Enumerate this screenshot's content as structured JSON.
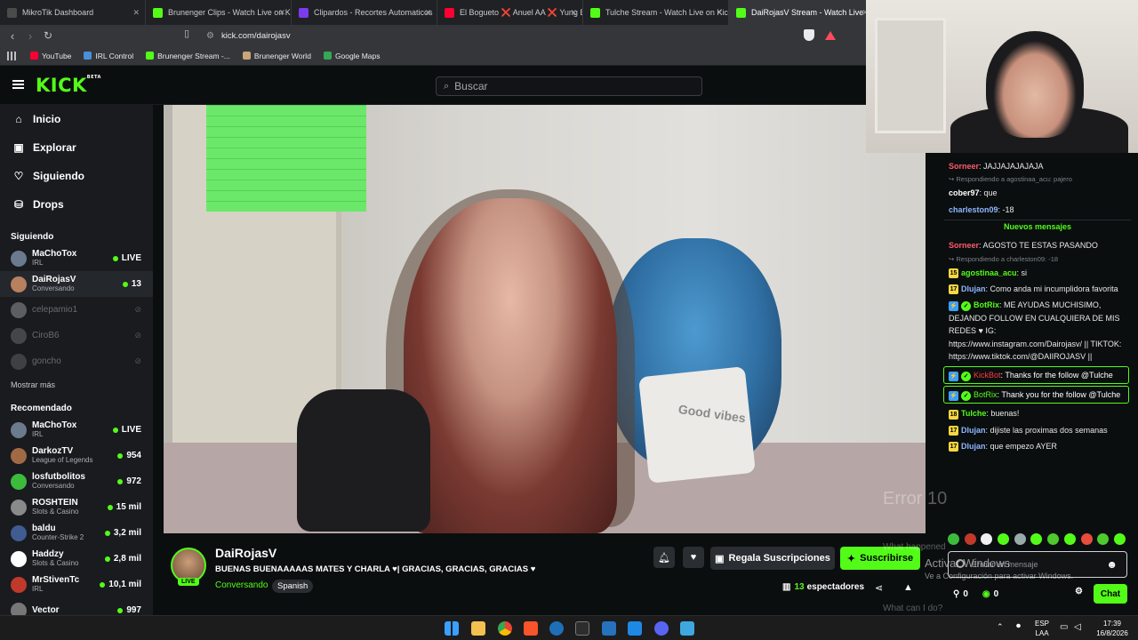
{
  "tabs": [
    {
      "label": "MikroTik Dashboard",
      "color": "#4b4b4b"
    },
    {
      "label": "Brunenger Clips - Watch Live on Kick",
      "color": "#53fc18"
    },
    {
      "label": "Clipardos - Recortes Automaticos",
      "color": "#7c3aed"
    },
    {
      "label": "El Bogueto ❌ Anuel AA ❌ Yung Be",
      "color": "#ff0033"
    },
    {
      "label": "Tulche Stream - Watch Live on Kick",
      "color": "#53fc18"
    },
    {
      "label": "DaiRojasV Stream - Watch Live",
      "color": "#53fc18"
    }
  ],
  "address": {
    "url": "kick.com/dairojasv"
  },
  "bookmarks": [
    {
      "label": "YouTube",
      "color": "#ff0033"
    },
    {
      "label": "IRL Control",
      "color": "#4a90d9"
    },
    {
      "label": "Brunenger Stream -...",
      "color": "#53fc18"
    },
    {
      "label": "Brunenger World",
      "color": "#caa57a"
    },
    {
      "label": "Google Maps",
      "color": "#34a853"
    }
  ],
  "header": {
    "logo": "KICK",
    "logo_badge": "BETA",
    "search_placeholder": "Buscar"
  },
  "sidebar": {
    "nav": [
      {
        "label": "Inicio",
        "icon": "home-icon",
        "glyph": "⌂"
      },
      {
        "label": "Explorar",
        "icon": "explore-icon",
        "glyph": "▣"
      },
      {
        "label": "Siguiendo",
        "icon": "heart-icon",
        "glyph": "♡"
      },
      {
        "label": "Drops",
        "icon": "drops-icon",
        "glyph": "⛁"
      }
    ],
    "following_title": "Siguiendo",
    "following": [
      {
        "name": "MaChoTox",
        "sub": "IRL",
        "status": "LIVE",
        "online": true,
        "color": "#6b7a8c"
      },
      {
        "name": "DaiRojasV",
        "sub": "Conversando",
        "status": "13",
        "online": true,
        "selected": true,
        "color": "#b7805e"
      },
      {
        "name": "celepamio1",
        "sub": "",
        "status": "",
        "online": false,
        "color": "#ddd"
      },
      {
        "name": "CiroB6",
        "sub": "",
        "status": "",
        "online": false,
        "color": "#999"
      },
      {
        "name": "goncho",
        "sub": "",
        "status": "",
        "online": false,
        "color": "#888"
      }
    ],
    "show_more": "Mostrar más",
    "recommended_title": "Recomendado",
    "recommended": [
      {
        "name": "MaChoTox",
        "sub": "IRL",
        "status": "LIVE",
        "color": "#6b7a8c"
      },
      {
        "name": "DarkozTV",
        "sub": "League of Legends",
        "status": "954",
        "color": "#a06a44"
      },
      {
        "name": "losfutbolitos",
        "sub": "Conversando",
        "status": "972",
        "color": "#3dbb3d"
      },
      {
        "name": "ROSHTEIN",
        "sub": "Slots & Casino",
        "status": "15 mil",
        "color": "#8a8a8a"
      },
      {
        "name": "baldu",
        "sub": "Counter-Strike 2",
        "status": "3,2 mil",
        "color": "#405c90"
      },
      {
        "name": "Haddzy",
        "sub": "Slots & Casino",
        "status": "2,8 mil",
        "color": "#ffffff"
      },
      {
        "name": "MrStivenTc",
        "sub": "IRL",
        "status": "10,1 mil",
        "color": "#c0392b"
      },
      {
        "name": "Vector",
        "sub": "",
        "status": "997",
        "color": "#777"
      }
    ]
  },
  "stream": {
    "pillow_text": "Good vibes",
    "name": "DaiRojasV",
    "live_badge": "LIVE",
    "title": "BUENAS BUENAAAAAS MATES Y CHARLA ♥| GRACIAS, GRACIAS, GRACIAS ♥",
    "category": "Conversando",
    "language": "Spanish",
    "gift_label": "Regala Suscripciones",
    "subscribe_label": "Suscribirse",
    "viewers_count": "13",
    "viewers_label": "espectadores"
  },
  "chat": {
    "messages": [
      {
        "type": "msg",
        "user": "Sorneer",
        "color": "#ff5a6e",
        "text": "JAJJAJAJAJAJA"
      },
      {
        "type": "reply",
        "text": "Respondiendo a agostinaa_acu: pajero"
      },
      {
        "type": "msg",
        "user": "cober97",
        "color": "#ffffff",
        "text": "que"
      },
      {
        "type": "msg",
        "user": "charleston09",
        "color": "#8fb6ff",
        "text": "-18"
      },
      {
        "type": "divider",
        "text": "Nuevos mensajes"
      },
      {
        "type": "msg",
        "user": "Sorneer",
        "color": "#ff5a6e",
        "text": "AGOSTO TE ESTAS PASANDO"
      },
      {
        "type": "reply",
        "text": "Respondiendo a charleston09: -18"
      },
      {
        "type": "msg",
        "user": "agostinaa_acu",
        "color": "#53fc18",
        "badge": "15",
        "text": "si"
      },
      {
        "type": "msg",
        "user": "Dlujan",
        "color": "#8fb6ff",
        "badge": "17",
        "text": "Como anda mi incumplidora favorita"
      },
      {
        "type": "msg",
        "user": "BotRix",
        "color": "#53fc18",
        "bot": true,
        "text": "ME AYUDAS MUCHISIMO, DEJANDO FOLLOW EN CUALQUIERA DE MIS REDES ♥ IG: https://www.instagram.com/Dairojasv/ || TIKTOK: https://www.tiktok.com/@DAIIROJASV ||"
      },
      {
        "type": "boxed",
        "user": "KickBot",
        "color": "#ff3b3b",
        "bot": true,
        "text": "Thanks for the follow @Tulche"
      },
      {
        "type": "boxed",
        "user": "BotRix",
        "color": "#53fc18",
        "bot": true,
        "text": "Thank you for the follow @Tulche"
      },
      {
        "type": "msg",
        "user": "Tulche",
        "color": "#53fc18",
        "badge": "18",
        "text": "buenas!"
      },
      {
        "type": "msg",
        "user": "Dlujan",
        "color": "#8fb6ff",
        "badge": "17",
        "text": "dijiste las proximas dos semanas"
      },
      {
        "type": "msg",
        "user": "Dlujan",
        "color": "#8fb6ff",
        "badge": "17",
        "text": "que empezo AYER"
      }
    ],
    "input_placeholder": "Enviar un mensaje",
    "points_a": "0",
    "points_b": "0",
    "send_label": "Chat"
  },
  "watermark": {
    "activate_title": "Activar Windows",
    "activate_sub": "Ve a Configuración para activar Windows.",
    "error_text": "Error 10",
    "what_happened": "What happened",
    "what_can": "What can I do?"
  },
  "taskbar": {
    "lang_top": "ESP",
    "lang_bottom": "LAA",
    "time": "17:39",
    "date": "16/8/2026"
  }
}
